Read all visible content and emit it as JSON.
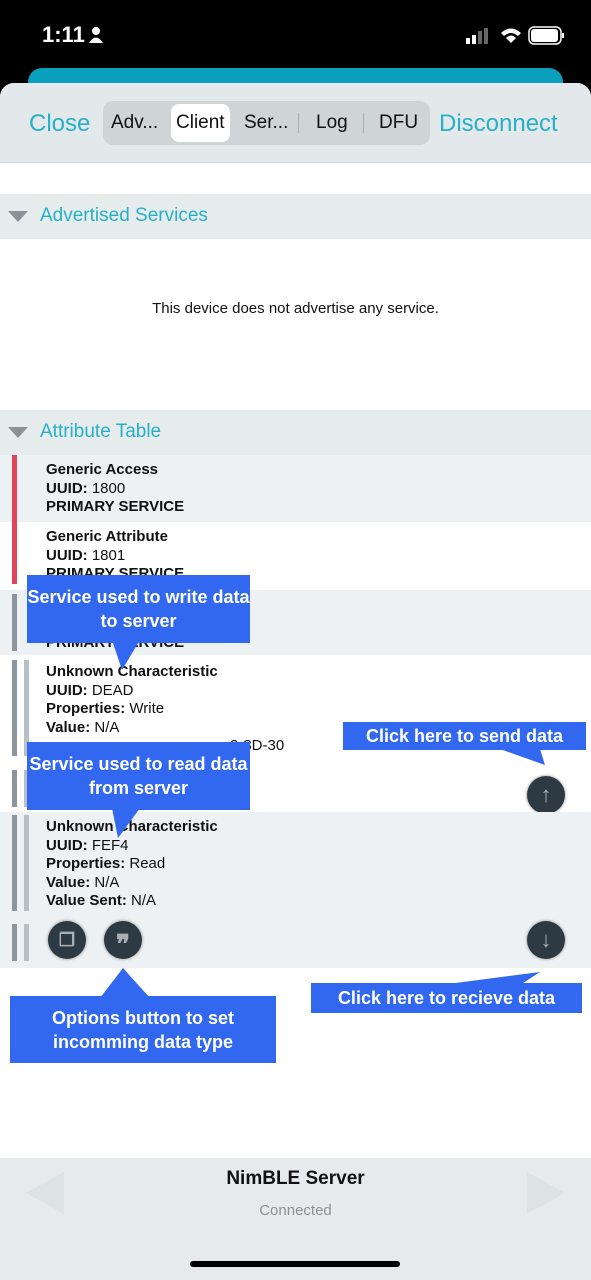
{
  "status": {
    "time": "1:11",
    "person_icon": "person-icon",
    "signal_icon": "cellular-signal-icon",
    "wifi_icon": "wifi-icon",
    "battery_icon": "battery-icon"
  },
  "nav": {
    "close": "Close",
    "disconnect": "Disconnect",
    "tabs": [
      {
        "label": "Adv..."
      },
      {
        "label": "Client",
        "selected": true
      },
      {
        "label": "Ser..."
      },
      {
        "label": "Log"
      },
      {
        "label": "DFU"
      }
    ]
  },
  "advertised": {
    "title": "Advertised Services",
    "empty_text": "This device does not advertise any service."
  },
  "attributes": {
    "title": "Attribute Table",
    "items": [
      {
        "name": "Generic Access",
        "uuid": "1800",
        "type": "PRIMARY SERVICE"
      },
      {
        "name": "Generic Attribute",
        "uuid": "1801",
        "type": "PRIMARY SERVICE"
      },
      {
        "type": "PRIMARY SERVICE"
      },
      {
        "name": "Unknown Characteristic",
        "uuid": "DEAD",
        "properties": "Write",
        "value": "N/A",
        "value_sent_visible": "2-3D-30"
      },
      {
        "name": "Unknown Characteristic",
        "uuid": "FEF4",
        "properties": "Read",
        "value": "N/A",
        "value_sent": "N/A"
      }
    ],
    "labels": {
      "uuid": "UUID:",
      "properties": "Properties:",
      "value": "Value:",
      "value_sent": "Value Sent:"
    }
  },
  "callouts": {
    "write": "Service used to write data to server",
    "send": "Click here to send data",
    "read": "Service used to read data from server",
    "options": "Options button to set incomming data type",
    "receive": "Click here to recieve data"
  },
  "bottom": {
    "title": "NimBLE Server",
    "status": "Connected"
  },
  "colors": {
    "accent": "#27b0c9",
    "callout": "#3268f0",
    "service_bar": "#e0455a",
    "char_bar": "#8c959b"
  }
}
